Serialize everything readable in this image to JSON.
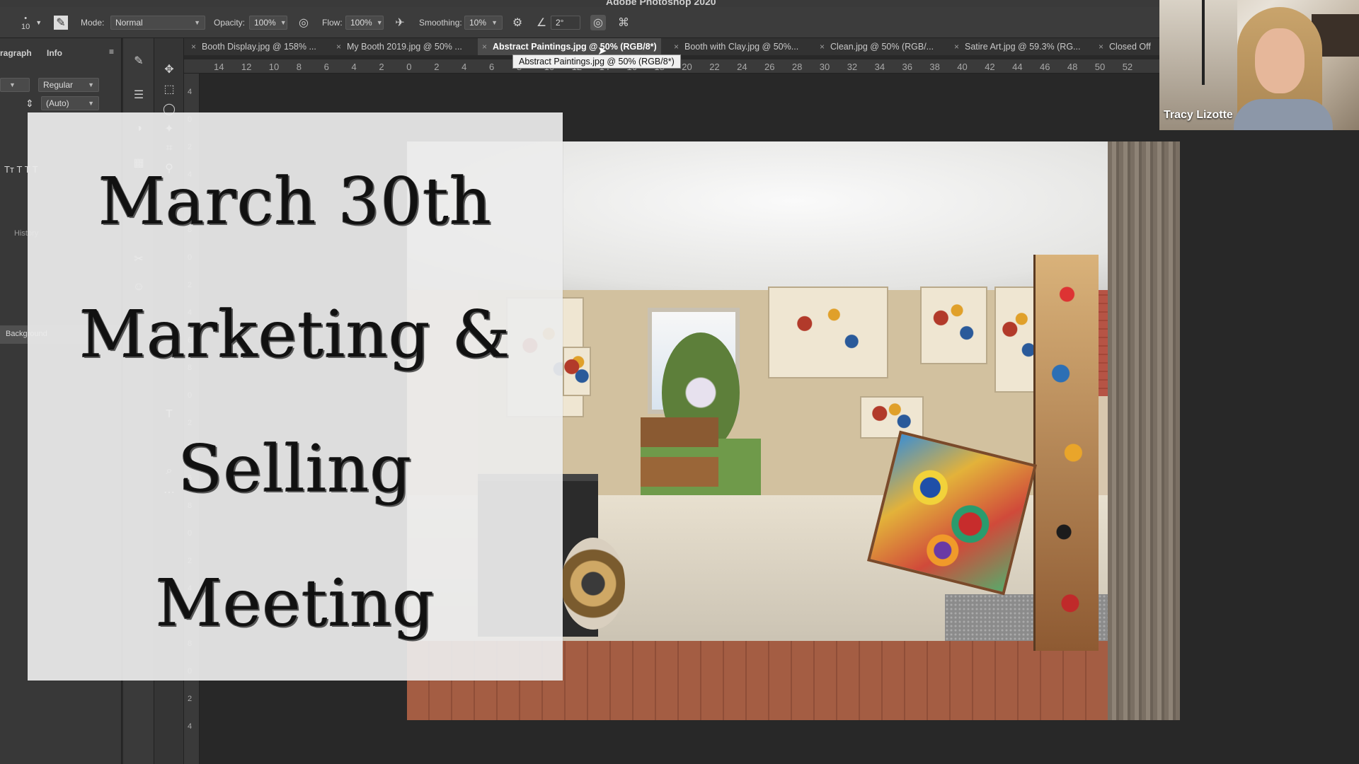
{
  "app": {
    "title": "Adobe Photoshop 2020"
  },
  "options_bar": {
    "brush_size": "10",
    "mode_label": "Mode:",
    "mode_value": "Normal",
    "opacity_label": "Opacity:",
    "opacity_value": "100%",
    "flow_label": "Flow:",
    "flow_value": "100%",
    "smoothing_label": "Smoothing:",
    "smoothing_value": "10%",
    "angle_value": "2°"
  },
  "left_panel": {
    "tab_paragraph": "ragraph",
    "tab_info": "Info",
    "font_style": "Regular",
    "leading": "(Auto)",
    "history_label": "History",
    "background_label": "Background"
  },
  "tabs": [
    {
      "label": "Booth Display.jpg @ 158% ...",
      "active": false
    },
    {
      "label": "My Booth 2019.jpg @ 50% ...",
      "active": false
    },
    {
      "label": "Abstract Paintings.jpg @ 50% (RGB/8*)",
      "active": true
    },
    {
      "label": "Booth with Clay.jpg @ 50%...",
      "active": false
    },
    {
      "label": "Clean.jpg @ 50% (RGB/...",
      "active": false
    },
    {
      "label": "Satire Art.jpg @ 59.3% (RG...",
      "active": false
    },
    {
      "label": "Closed Off",
      "active": false
    }
  ],
  "tooltip": "Abstract Paintings.jpg @ 50% (RGB/8*)",
  "ruler_h": [
    "14",
    "12",
    "10",
    "8",
    "6",
    "4",
    "2",
    "0",
    "2",
    "4",
    "6",
    "8",
    "10",
    "12",
    "14",
    "16",
    "18",
    "20",
    "22",
    "24",
    "26",
    "28",
    "30",
    "32",
    "34",
    "36",
    "38",
    "40",
    "42",
    "44",
    "46",
    "48",
    "50",
    "52"
  ],
  "ruler_v": [
    "4",
    "0",
    "2",
    "4",
    "6",
    "8",
    "0",
    "2",
    "4",
    "6",
    "8",
    "0",
    "2",
    "4",
    "6",
    "8",
    "0",
    "2",
    "4",
    "6",
    "8",
    "0",
    "2",
    "4"
  ],
  "title_card": {
    "line1": "March 30th",
    "line2": "Marketing &",
    "line3": "Selling",
    "line4": "Meeting"
  },
  "webcam": {
    "participant_name": "Tracy Lizotte"
  }
}
